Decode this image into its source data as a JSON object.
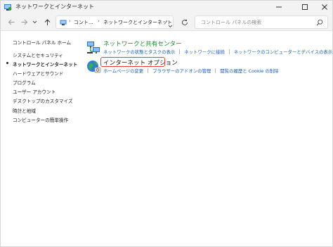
{
  "window": {
    "title": "ネットワークとインターネット",
    "controls": {
      "minimize": "minimize",
      "maximize": "maximize",
      "close": "close"
    }
  },
  "address": {
    "crumbs": [
      "コント...",
      "ネットワークとインターネット"
    ],
    "refresh_icon": "refresh-icon"
  },
  "search": {
    "placeholder": "コントロール パネルの検索"
  },
  "sidebar": {
    "home": "コントロール パネル ホーム",
    "items": [
      {
        "label": "システムとセキュリティ",
        "active": false
      },
      {
        "label": "ネットワークとインターネット",
        "active": true
      },
      {
        "label": "ハードウェアとサウンド",
        "active": false
      },
      {
        "label": "プログラム",
        "active": false
      },
      {
        "label": "ユーザー アカウント",
        "active": false
      },
      {
        "label": "デスクトップのカスタマイズ",
        "active": false
      },
      {
        "label": "時計と地域",
        "active": false
      },
      {
        "label": "コンピューターの簡単操作",
        "active": false
      }
    ]
  },
  "main": {
    "categories": [
      {
        "title": "ネットワークと共有センター",
        "icon": "network-icon",
        "links": [
          "ネットワークの状態とタスクの表示",
          "ネットワークに接続",
          "ネットワークのコンピューターとデバイスの表示"
        ]
      },
      {
        "title": "インターネット オプション",
        "icon": "internet-options-icon",
        "highlighted": true,
        "links": [
          "ホームページの変更",
          "ブラウザーのアドオンの管理",
          "閲覧の履歴と Cookie の削除"
        ]
      }
    ]
  },
  "colors": {
    "category_title": "#1e8a2e",
    "link": "#1a5fb4",
    "highlight": "#e0403a"
  }
}
